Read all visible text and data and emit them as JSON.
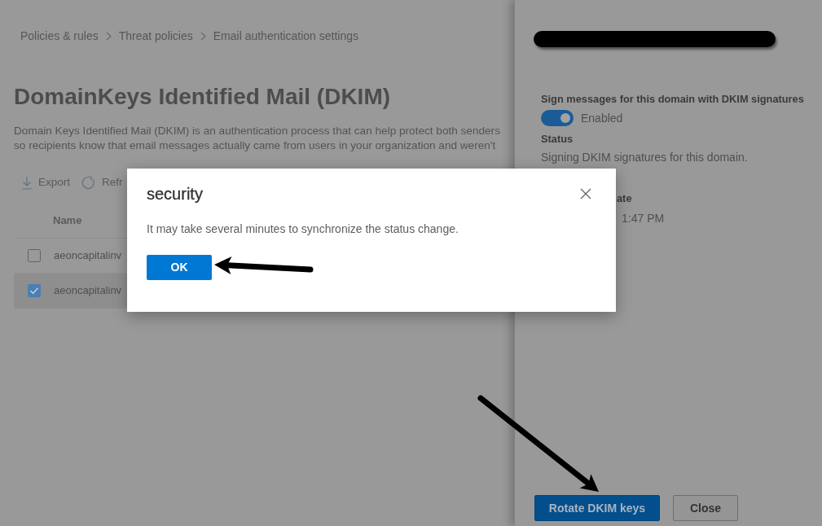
{
  "breadcrumb": [
    {
      "label": "Policies & rules"
    },
    {
      "label": "Threat policies"
    },
    {
      "label": "Email authentication settings"
    }
  ],
  "page_title": "DomainKeys Identified Mail (DKIM)",
  "description_lines": [
    "Domain Keys Identified Mail (DKIM) is an authentication process that can help protect both senders",
    "so recipients know that email messages actually came from users in your organization and weren't"
  ],
  "toolbar": [
    {
      "kind": "export",
      "label": "Export"
    },
    {
      "kind": "refresh",
      "label": "Refr"
    }
  ],
  "table": {
    "columns": [
      "Name"
    ],
    "rows": [
      {
        "name": "aeoncapitalinv",
        "selected": false
      },
      {
        "name": "aeoncapitalinv",
        "selected": true
      }
    ]
  },
  "details_panel": {
    "title_redacted": true,
    "fields": [
      {
        "kind": "toggle",
        "label": "Sign messages for this domain with DKIM signatures",
        "on": true,
        "value": "Enabled"
      },
      {
        "kind": "text",
        "label": "Status",
        "value": "Signing DKIM signatures for this domain."
      },
      {
        "kind": "covered",
        "label": "ate",
        "value": "1:47 PM"
      }
    ],
    "buttons": [
      {
        "kind": "primary",
        "label": "Rotate DKIM keys"
      },
      {
        "kind": "default",
        "label": "Close"
      }
    ]
  },
  "dialog": {
    "title": "security",
    "message": "It may take several minutes to synchronize the status change.",
    "buttons": [
      {
        "kind": "primary",
        "label": "OK"
      }
    ]
  },
  "annotations": [
    {
      "kind": "arrow"
    },
    {
      "kind": "arrow"
    }
  ]
}
